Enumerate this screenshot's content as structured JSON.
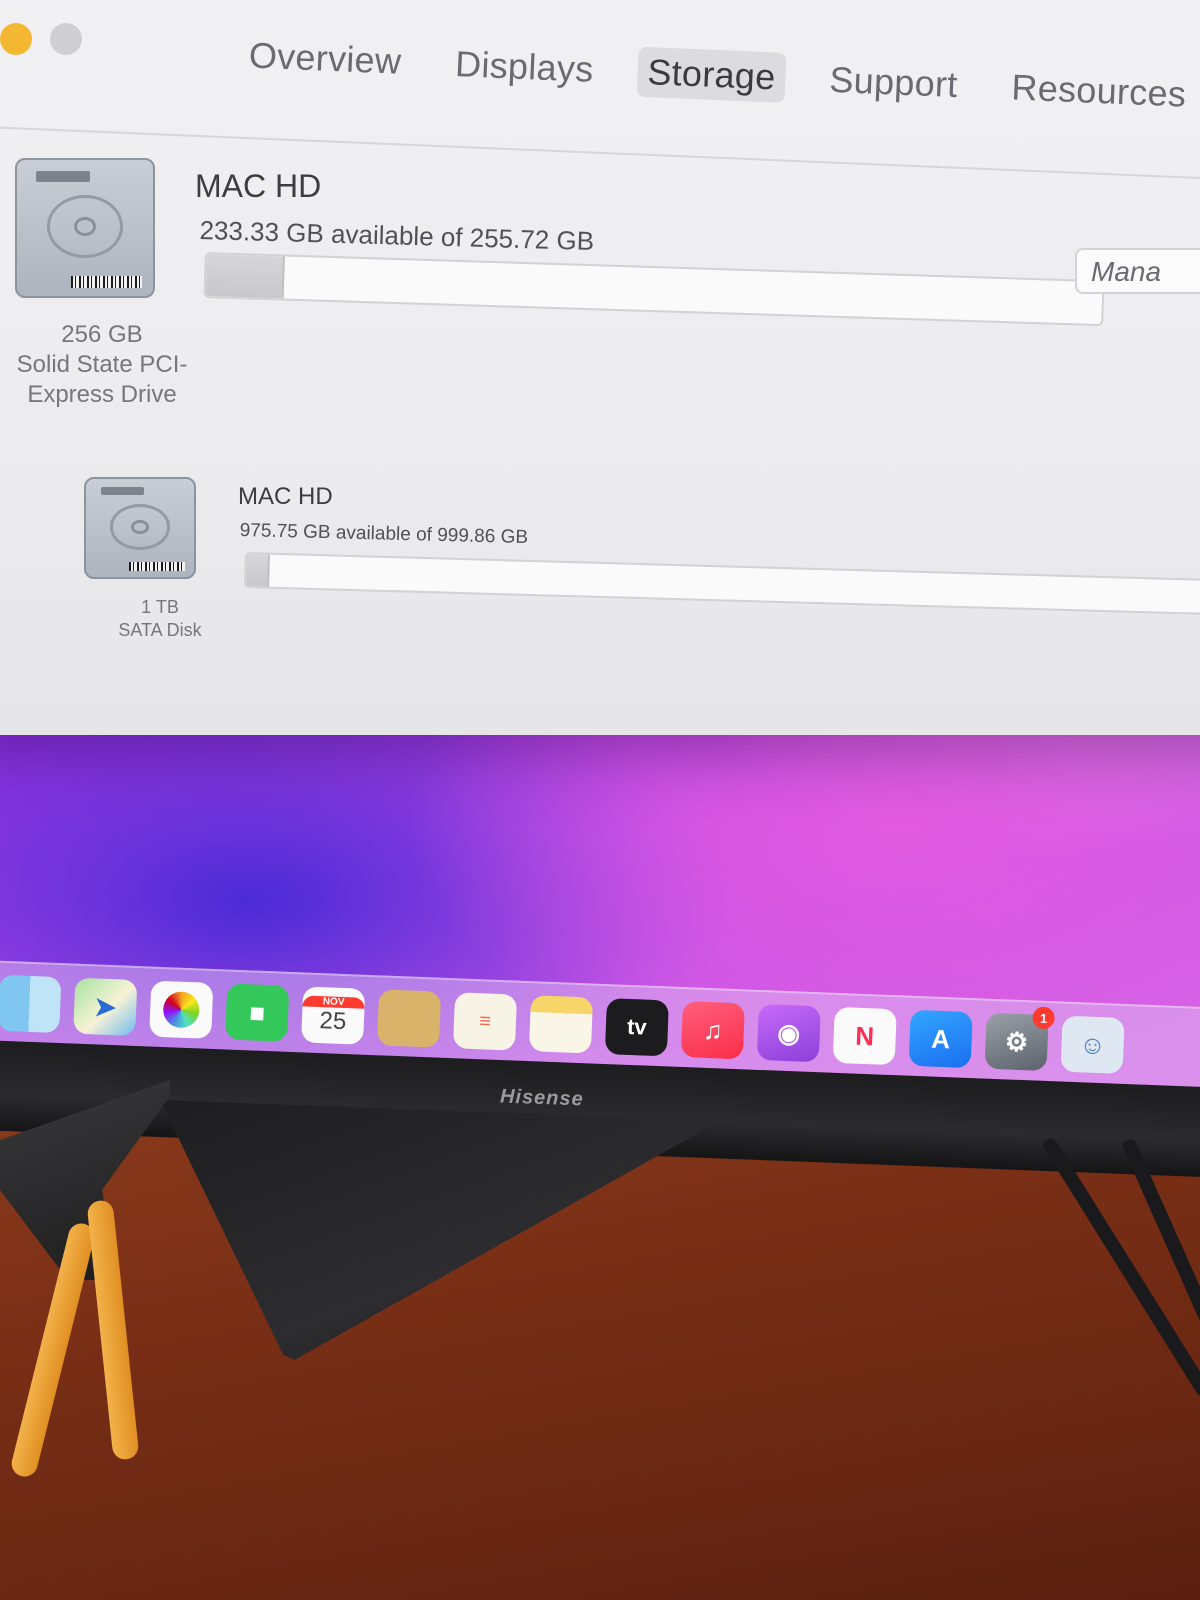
{
  "window": {
    "tabs": [
      "Overview",
      "Displays",
      "Storage",
      "Support",
      "Resources"
    ],
    "active_tab": "Storage",
    "manage_label": "Mana",
    "drives": [
      {
        "volume_name": "MAC HD",
        "availability": "233.33 GB available of 255.72 GB",
        "used_fraction": 0.087,
        "capacity": "256 GB",
        "type_line1": "Solid State PCI-",
        "type_line2": "Express Drive"
      },
      {
        "volume_name": "MAC HD",
        "availability": "975.75 GB available of 999.86 GB",
        "used_fraction": 0.024,
        "capacity": "1 TB",
        "type_line1": "SATA Disk",
        "type_line2": ""
      }
    ]
  },
  "dock": {
    "apps": [
      {
        "name": "finder",
        "glyph": ""
      },
      {
        "name": "maps",
        "glyph": "➤"
      },
      {
        "name": "photos",
        "glyph": ""
      },
      {
        "name": "facetime",
        "glyph": "■"
      },
      {
        "name": "calendar",
        "month": "NOV",
        "day": "25"
      },
      {
        "name": "contacts",
        "glyph": ""
      },
      {
        "name": "reminders",
        "glyph": "≡"
      },
      {
        "name": "notes",
        "glyph": ""
      },
      {
        "name": "tv",
        "glyph": "tv"
      },
      {
        "name": "music",
        "glyph": "♫"
      },
      {
        "name": "podcasts",
        "glyph": "◉"
      },
      {
        "name": "news",
        "glyph": "N"
      },
      {
        "name": "app-store",
        "glyph": "A"
      },
      {
        "name": "system-preferences",
        "glyph": "⚙",
        "badge": "1"
      },
      {
        "name": "preview",
        "glyph": "☺"
      }
    ]
  },
  "monitor": {
    "brand": "Hisense"
  },
  "colors": {
    "window_bg": "#ececee",
    "traffic_yellow": "#f4b731",
    "wallpaper_purple": "#a035e0",
    "desk_wood": "#7a2f16"
  }
}
